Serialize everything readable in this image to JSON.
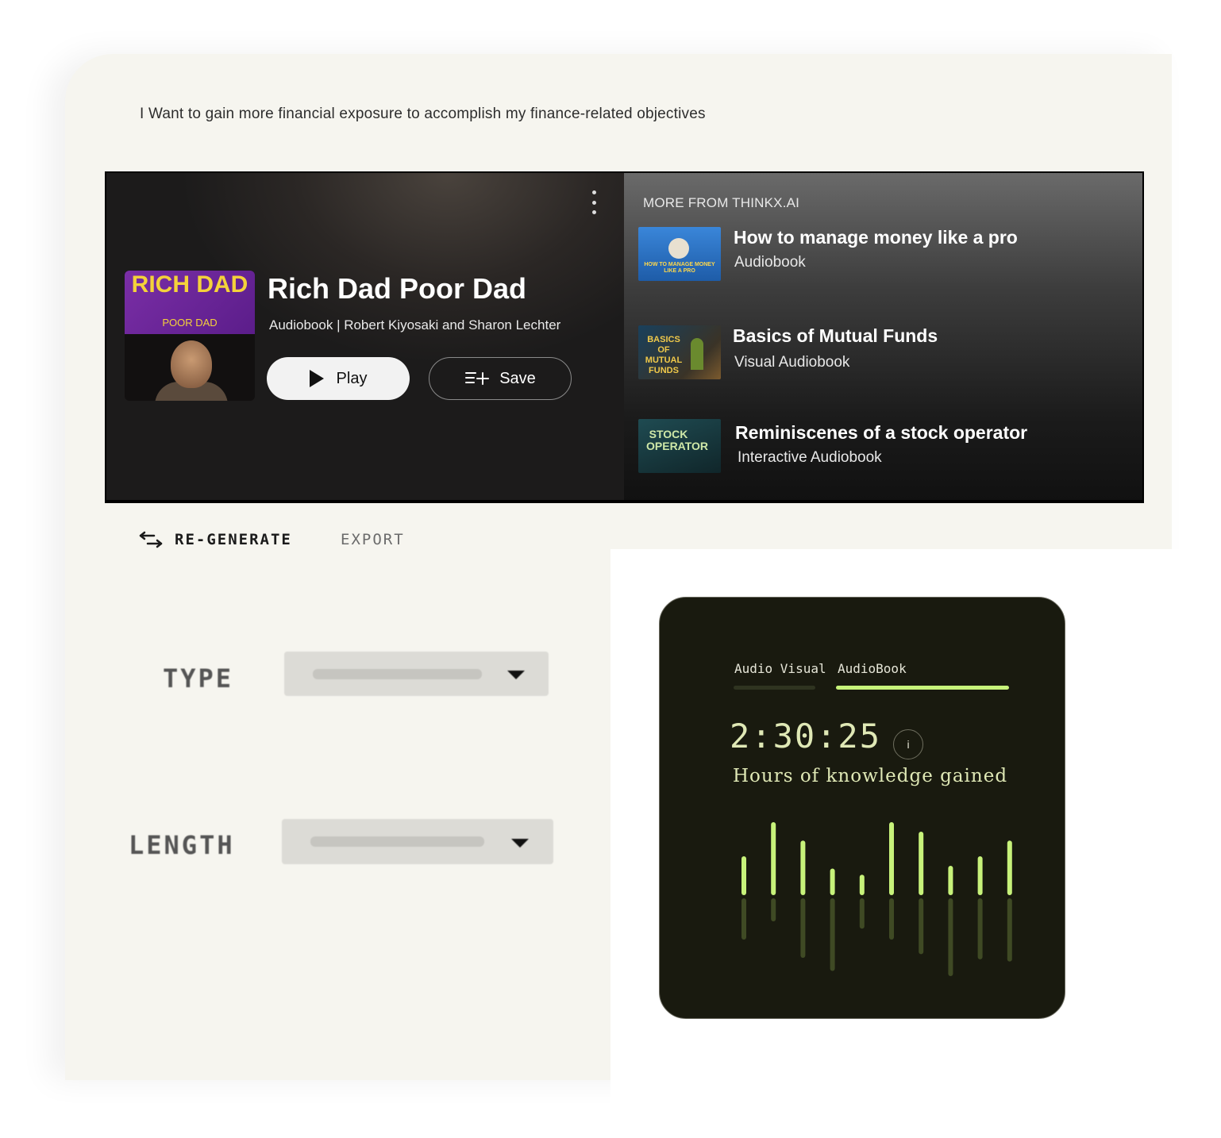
{
  "prompt": "I Want to gain more financial exposure to accomplish my finance-related objectives",
  "featured": {
    "cover": {
      "title": "RICH DAD",
      "subtitle": "POOR DAD"
    },
    "title": "Rich Dad Poor Dad",
    "meta": "Audiobook | Robert Kiyosaki and Sharon Lechter",
    "play_label": "Play",
    "save_label": "Save"
  },
  "more": {
    "heading": "MORE FROM THINKX.AI",
    "items": [
      {
        "title": "How to manage money like a pro",
        "type": "Audiobook",
        "thumb_text": "HOW TO MANAGE MONEY LIKE A PRO"
      },
      {
        "title": "Basics of Mutual Funds",
        "type": "Visual Audiobook",
        "thumb_text": "BASICS OF MUTUAL FUNDS"
      },
      {
        "title": "Reminiscenes of a stock operator",
        "type": "Interactive Audiobook",
        "thumb_text": "STOCK OPERATOR"
      }
    ]
  },
  "actions": {
    "regenerate": "RE-GENERATE",
    "export": "EXPORT"
  },
  "fields": {
    "type_label": "TYPE",
    "length_label": "LENGTH"
  },
  "stats": {
    "tab_1": "Audio Visual",
    "tab_2": "AudioBook",
    "timer": "2:30:25",
    "info": "i",
    "caption": "Hours of knowledge gained",
    "accent": "#c7f27a",
    "wave_up": [
      0.5,
      1.0,
      0.73,
      0.32,
      0.23,
      1.0,
      0.86,
      0.36,
      0.5,
      0.73
    ],
    "wave_down": [
      0.5,
      0.25,
      0.75,
      0.93,
      0.35,
      0.5,
      0.7,
      1.0,
      0.77,
      0.8
    ]
  },
  "colors": {
    "panel": "#f6f5ef",
    "card_dark": "#191a0f",
    "accent": "#c7f27a"
  }
}
